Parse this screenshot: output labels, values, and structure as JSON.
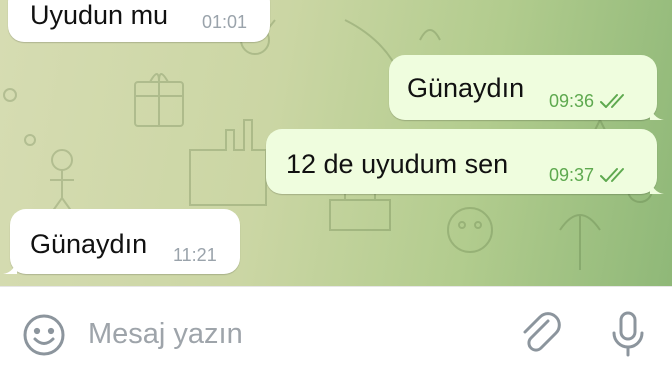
{
  "messages": [
    {
      "text": "Uyudun mu",
      "time": "01:01",
      "direction": "incoming"
    },
    {
      "text": "Günaydın",
      "time": "09:36",
      "direction": "outgoing",
      "status_icon": "double-check-icon"
    },
    {
      "text": "12 de uyudum sen",
      "time": "09:37",
      "direction": "outgoing",
      "status_icon": "double-check-icon"
    },
    {
      "text": "Günaydın",
      "time": "11:21",
      "direction": "incoming"
    }
  ],
  "composer": {
    "placeholder": "Mesaj yazın",
    "emoji_icon": "emoji-icon",
    "attach_icon": "paperclip-icon",
    "mic_icon": "microphone-icon"
  },
  "colors": {
    "incoming_bubble": "#ffffff",
    "outgoing_bubble": "#effdde",
    "outgoing_meta": "#5ea94f",
    "incoming_meta": "#9aa3ab",
    "icon_gray": "#8c959d"
  }
}
